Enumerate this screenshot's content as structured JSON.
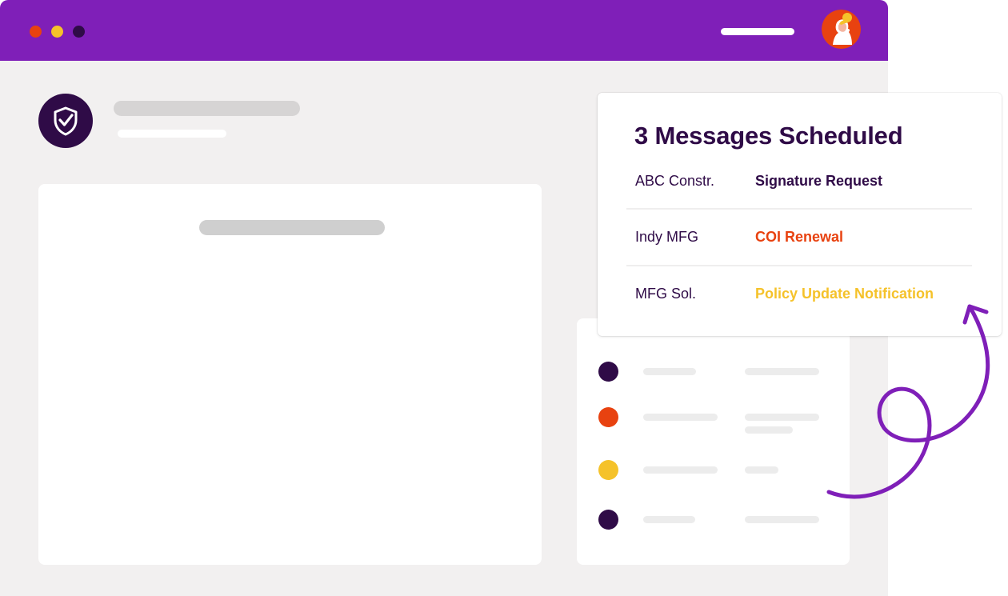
{
  "colors": {
    "brand_purple": "#7f1fb8",
    "deep_purple": "#2f0b47",
    "orange": "#e84210",
    "yellow": "#f5c22a",
    "window_bg": "#f2f0f0",
    "placeholder_gray": "#cfcfcf",
    "placeholder_light": "#ececec"
  },
  "window": {
    "traffic_lights": [
      "close",
      "minimize",
      "maximize"
    ]
  },
  "header": {
    "avatar_icon": "user-avatar-icon"
  },
  "logo": {
    "icon": "shield-check-icon"
  },
  "popup": {
    "title": "3 Messages Scheduled",
    "rows": [
      {
        "company": "ABC Constr.",
        "subject": "Signature Request",
        "status": "deep_purple"
      },
      {
        "company": "Indy MFG",
        "subject": "COI Renewal",
        "status": "orange"
      },
      {
        "company": "MFG Sol.",
        "subject": "Policy Update Notification",
        "status": "yellow"
      }
    ]
  },
  "list": {
    "dot_colors": [
      "#2f0b47",
      "#e84210",
      "#f5c22a",
      "#2f0b47"
    ]
  }
}
